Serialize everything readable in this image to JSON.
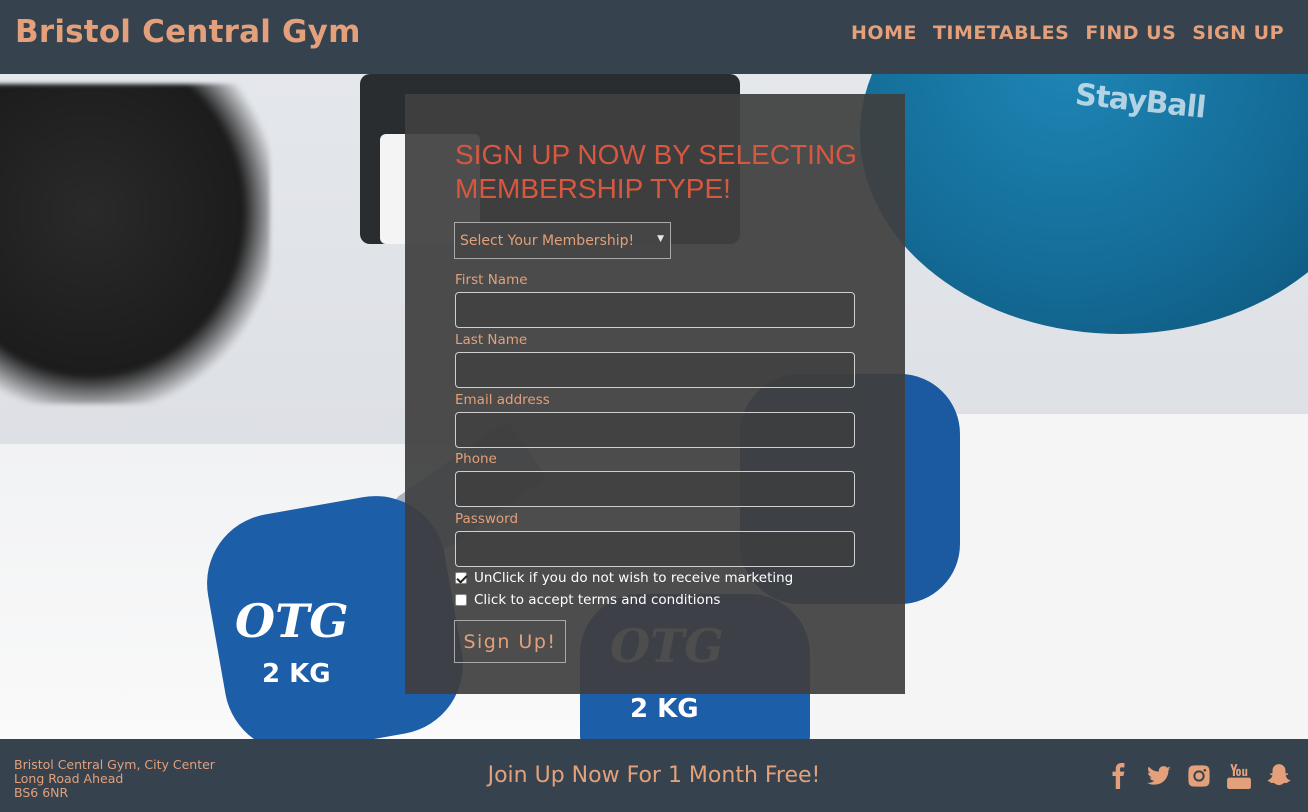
{
  "header": {
    "brand": "Bristol Central Gym",
    "nav": [
      "HOME",
      "TIMETABLES",
      "FIND US",
      "SIGN UP"
    ]
  },
  "hero": {
    "ball_text": "StayBall",
    "dumbbell_logo": "OTG",
    "dumbbell_weight": "2 KG"
  },
  "form": {
    "title": "SIGN UP NOW BY SELECTING MEMBERSHIP TYPE!",
    "membership_select": "Select Your Membership!",
    "fields": [
      {
        "label": "First Name",
        "value": ""
      },
      {
        "label": "Last Name",
        "value": ""
      },
      {
        "label": "Email address",
        "value": ""
      },
      {
        "label": "Phone",
        "value": ""
      },
      {
        "label": "Password",
        "value": ""
      }
    ],
    "checkboxes": [
      {
        "label": "UnClick if you do not wish to receive marketing",
        "checked": true
      },
      {
        "label": "Click to accept terms and conditions",
        "checked": false
      }
    ],
    "submit_label": "Sign Up!"
  },
  "footer": {
    "address": [
      "Bristol Central Gym, City Center",
      "Long Road Ahead",
      "BS6 6NR"
    ],
    "promo": "Join Up Now For 1 Month Free!",
    "social_icons": [
      "facebook-icon",
      "twitter-icon",
      "instagram-icon",
      "youtube-icon",
      "snapchat-icon"
    ]
  },
  "colors": {
    "header_bg": "#36434f",
    "accent": "#e3a07a",
    "title_red": "#d8573f",
    "panel_bg": "#404040"
  }
}
